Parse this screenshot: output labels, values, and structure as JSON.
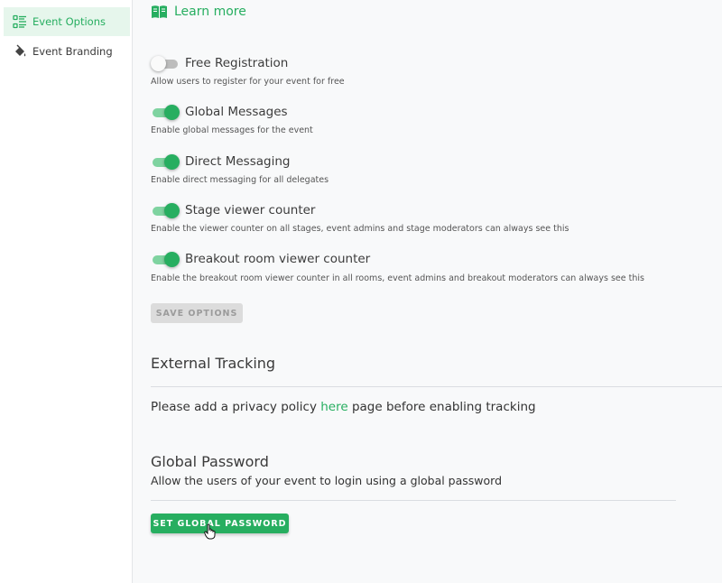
{
  "sidebar": {
    "items": [
      {
        "label": "Event Options",
        "icon": "list-settings-icon",
        "active": true
      },
      {
        "label": "Event Branding",
        "icon": "paint-bucket-icon",
        "active": false
      }
    ]
  },
  "main": {
    "learn_more": {
      "label": "Learn more",
      "icon": "book-icon"
    },
    "toggles": [
      {
        "label": "Free Registration",
        "description": "Allow users to register for your event for free",
        "on": false
      },
      {
        "label": "Global Messages",
        "description": "Enable global messages for the event",
        "on": true
      },
      {
        "label": "Direct Messaging",
        "description": "Enable direct messaging for all delegates",
        "on": true
      },
      {
        "label": "Stage viewer counter",
        "description": "Enable the viewer counter on all stages, event admins and stage moderators can always see this",
        "on": true
      },
      {
        "label": "Breakout room viewer counter",
        "description": "Enable the breakout room viewer counter in all rooms, event admins and breakout moderators can always see this",
        "on": true
      }
    ],
    "save_options_label": "SAVE OPTIONS",
    "external_tracking": {
      "title": "External Tracking",
      "text_before": "Please add a privacy policy ",
      "link": "here",
      "text_after": " page before enabling tracking"
    },
    "global_password": {
      "title": "Global Password",
      "description": "Allow the users of your event to login using a global password",
      "button_label": "SET GLOBAL PASSWORD"
    }
  },
  "colors": {
    "accent": "#27ae60",
    "accent_light": "#e6f6ec",
    "disabled": "#dcdcdc"
  }
}
